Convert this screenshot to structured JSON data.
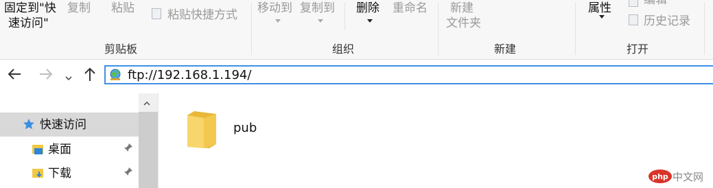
{
  "ribbon": {
    "clipboard": {
      "pin_label_line1": "固定到\"快",
      "pin_label_line2": "速访问\"",
      "copy_label": "复制",
      "paste_label": "粘贴",
      "paste_shortcut_label": "粘贴快捷方式",
      "group_label": "剪贴板"
    },
    "organize": {
      "move_to_label": "移动到",
      "copy_to_label": "复制到",
      "delete_label": "删除",
      "rename_label": "重命名",
      "group_label": "组织"
    },
    "new": {
      "new_folder_line1": "新建",
      "new_folder_line2": "文件夹",
      "group_label": "新建"
    },
    "open": {
      "properties_label": "属性",
      "edit_label": "编辑",
      "history_label": "历史记录",
      "group_label": "打开"
    }
  },
  "address_bar": {
    "path": "ftp://192.168.1.194/"
  },
  "nav_pane": {
    "items": [
      {
        "label": "快速访问"
      },
      {
        "label": "桌面"
      },
      {
        "label": "下载"
      }
    ]
  },
  "content": {
    "items": [
      {
        "name": "pub"
      }
    ]
  },
  "watermark": {
    "text": "中文网",
    "logo_text": "php"
  }
}
